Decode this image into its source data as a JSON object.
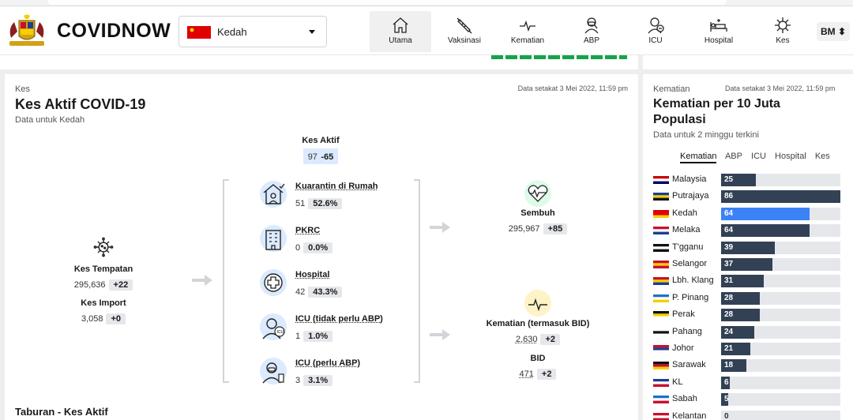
{
  "header": {
    "brand": "COVIDNOW",
    "state": "Kedah",
    "nav": [
      {
        "label": "Utama",
        "icon": "home-icon"
      },
      {
        "label": "Vaksinasi",
        "icon": "syringe-icon"
      },
      {
        "label": "Kematian",
        "icon": "pulse-icon"
      },
      {
        "label": "ABP",
        "icon": "ventilator-person-icon"
      },
      {
        "label": "ICU",
        "icon": "icu-person-icon"
      },
      {
        "label": "Hospital",
        "icon": "hospital-bed-icon"
      },
      {
        "label": "Kes",
        "icon": "virus-icon"
      }
    ],
    "language": "BM ⬍"
  },
  "cases_panel": {
    "category": "Kes",
    "title": "Kes Aktif COVID-19",
    "subtitle": "Data untuk Kedah",
    "updated": "Data setakat 3 Mei 2022, 11:59 pm",
    "local": {
      "label": "Kes Tempatan",
      "value": "295,636",
      "delta": "+22"
    },
    "import": {
      "label": "Kes Import",
      "value": "3,058",
      "delta": "+0"
    },
    "active": {
      "label": "Kes Aktif",
      "value": "97",
      "delta": "-65"
    },
    "breakdown": [
      {
        "label": "Kuarantin di Rumah",
        "value": "51",
        "pct": "52.6%",
        "icon": "home-quarantine-icon"
      },
      {
        "label": "PKRC",
        "value": "0",
        "pct": "0.0%",
        "icon": "building-icon"
      },
      {
        "label": "Hospital",
        "value": "42",
        "pct": "43.3%",
        "icon": "medical-cross-icon"
      },
      {
        "label": "ICU (tidak perlu ABP)",
        "value": "1",
        "pct": "1.0%",
        "icon": "icu-person-icon"
      },
      {
        "label": "ICU (perlu ABP)",
        "value": "3",
        "pct": "3.1%",
        "icon": "ventilator-person-icon"
      }
    ],
    "recovered": {
      "label": "Sembuh",
      "value": "295,967",
      "delta": "+85"
    },
    "deaths": {
      "label": "Kematian (termasuk BID)",
      "value": "2,630",
      "delta": "+2"
    },
    "bid": {
      "label": "BID",
      "value": "471",
      "delta": "+2"
    },
    "next_section": "Taburan - Kes Aktif"
  },
  "deaths_panel": {
    "category": "Kematian",
    "updated": "Data setakat 3 Mei 2022, 11:59 pm",
    "title": "Kematian per 10 Juta Populasi",
    "subtitle": "Data untuk 2 minggu terkini",
    "tabs": [
      "Kematian",
      "ABP",
      "ICU",
      "Hospital",
      "Kes"
    ],
    "active_tab": "Kematian",
    "highlight_color": "#3b82f6",
    "bar_color": "#334155"
  },
  "chart_data": {
    "type": "bar",
    "orientation": "horizontal",
    "categories": [
      "Malaysia",
      "Putrajaya",
      "Kedah",
      "Melaka",
      "T'gganu",
      "Selangor",
      "Lbh. Klang",
      "P. Pinang",
      "Perak",
      "Pahang",
      "Johor",
      "Sarawak",
      "KL",
      "Sabah",
      "Kelantan"
    ],
    "values": [
      25,
      86,
      64,
      64,
      39,
      37,
      31,
      28,
      28,
      24,
      21,
      18,
      6,
      5,
      0
    ],
    "highlight": "Kedah",
    "xlim": [
      0,
      86
    ]
  }
}
